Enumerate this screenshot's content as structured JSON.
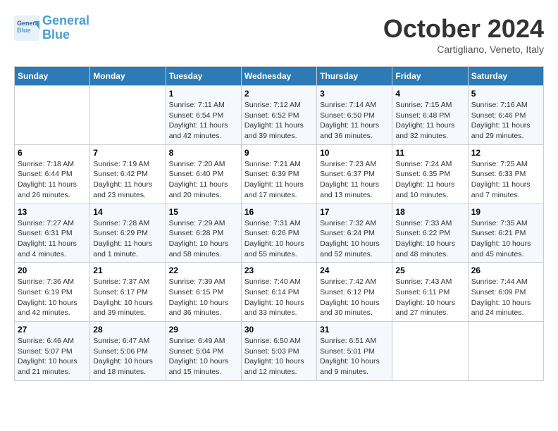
{
  "header": {
    "logo_line1": "General",
    "logo_line2": "Blue",
    "month_title": "October 2024",
    "location": "Cartigliano, Veneto, Italy"
  },
  "weekdays": [
    "Sunday",
    "Monday",
    "Tuesday",
    "Wednesday",
    "Thursday",
    "Friday",
    "Saturday"
  ],
  "weeks": [
    [
      {
        "day": "",
        "info": ""
      },
      {
        "day": "",
        "info": ""
      },
      {
        "day": "1",
        "info": "Sunrise: 7:11 AM\nSunset: 6:54 PM\nDaylight: 11 hours and 42 minutes."
      },
      {
        "day": "2",
        "info": "Sunrise: 7:12 AM\nSunset: 6:52 PM\nDaylight: 11 hours and 39 minutes."
      },
      {
        "day": "3",
        "info": "Sunrise: 7:14 AM\nSunset: 6:50 PM\nDaylight: 11 hours and 36 minutes."
      },
      {
        "day": "4",
        "info": "Sunrise: 7:15 AM\nSunset: 6:48 PM\nDaylight: 11 hours and 32 minutes."
      },
      {
        "day": "5",
        "info": "Sunrise: 7:16 AM\nSunset: 6:46 PM\nDaylight: 11 hours and 29 minutes."
      }
    ],
    [
      {
        "day": "6",
        "info": "Sunrise: 7:18 AM\nSunset: 6:44 PM\nDaylight: 11 hours and 26 minutes."
      },
      {
        "day": "7",
        "info": "Sunrise: 7:19 AM\nSunset: 6:42 PM\nDaylight: 11 hours and 23 minutes."
      },
      {
        "day": "8",
        "info": "Sunrise: 7:20 AM\nSunset: 6:40 PM\nDaylight: 11 hours and 20 minutes."
      },
      {
        "day": "9",
        "info": "Sunrise: 7:21 AM\nSunset: 6:39 PM\nDaylight: 11 hours and 17 minutes."
      },
      {
        "day": "10",
        "info": "Sunrise: 7:23 AM\nSunset: 6:37 PM\nDaylight: 11 hours and 13 minutes."
      },
      {
        "day": "11",
        "info": "Sunrise: 7:24 AM\nSunset: 6:35 PM\nDaylight: 11 hours and 10 minutes."
      },
      {
        "day": "12",
        "info": "Sunrise: 7:25 AM\nSunset: 6:33 PM\nDaylight: 11 hours and 7 minutes."
      }
    ],
    [
      {
        "day": "13",
        "info": "Sunrise: 7:27 AM\nSunset: 6:31 PM\nDaylight: 11 hours and 4 minutes."
      },
      {
        "day": "14",
        "info": "Sunrise: 7:28 AM\nSunset: 6:29 PM\nDaylight: 11 hours and 1 minute."
      },
      {
        "day": "15",
        "info": "Sunrise: 7:29 AM\nSunset: 6:28 PM\nDaylight: 10 hours and 58 minutes."
      },
      {
        "day": "16",
        "info": "Sunrise: 7:31 AM\nSunset: 6:26 PM\nDaylight: 10 hours and 55 minutes."
      },
      {
        "day": "17",
        "info": "Sunrise: 7:32 AM\nSunset: 6:24 PM\nDaylight: 10 hours and 52 minutes."
      },
      {
        "day": "18",
        "info": "Sunrise: 7:33 AM\nSunset: 6:22 PM\nDaylight: 10 hours and 48 minutes."
      },
      {
        "day": "19",
        "info": "Sunrise: 7:35 AM\nSunset: 6:21 PM\nDaylight: 10 hours and 45 minutes."
      }
    ],
    [
      {
        "day": "20",
        "info": "Sunrise: 7:36 AM\nSunset: 6:19 PM\nDaylight: 10 hours and 42 minutes."
      },
      {
        "day": "21",
        "info": "Sunrise: 7:37 AM\nSunset: 6:17 PM\nDaylight: 10 hours and 39 minutes."
      },
      {
        "day": "22",
        "info": "Sunrise: 7:39 AM\nSunset: 6:15 PM\nDaylight: 10 hours and 36 minutes."
      },
      {
        "day": "23",
        "info": "Sunrise: 7:40 AM\nSunset: 6:14 PM\nDaylight: 10 hours and 33 minutes."
      },
      {
        "day": "24",
        "info": "Sunrise: 7:42 AM\nSunset: 6:12 PM\nDaylight: 10 hours and 30 minutes."
      },
      {
        "day": "25",
        "info": "Sunrise: 7:43 AM\nSunset: 6:11 PM\nDaylight: 10 hours and 27 minutes."
      },
      {
        "day": "26",
        "info": "Sunrise: 7:44 AM\nSunset: 6:09 PM\nDaylight: 10 hours and 24 minutes."
      }
    ],
    [
      {
        "day": "27",
        "info": "Sunrise: 6:46 AM\nSunset: 5:07 PM\nDaylight: 10 hours and 21 minutes."
      },
      {
        "day": "28",
        "info": "Sunrise: 6:47 AM\nSunset: 5:06 PM\nDaylight: 10 hours and 18 minutes."
      },
      {
        "day": "29",
        "info": "Sunrise: 6:49 AM\nSunset: 5:04 PM\nDaylight: 10 hours and 15 minutes."
      },
      {
        "day": "30",
        "info": "Sunrise: 6:50 AM\nSunset: 5:03 PM\nDaylight: 10 hours and 12 minutes."
      },
      {
        "day": "31",
        "info": "Sunrise: 6:51 AM\nSunset: 5:01 PM\nDaylight: 10 hours and 9 minutes."
      },
      {
        "day": "",
        "info": ""
      },
      {
        "day": "",
        "info": ""
      }
    ]
  ]
}
